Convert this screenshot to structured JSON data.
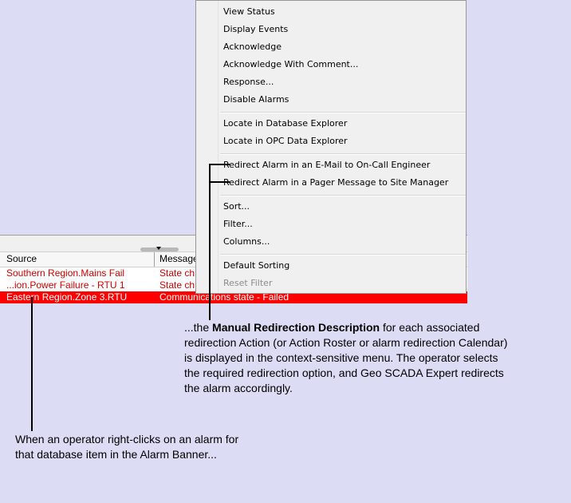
{
  "banner": {
    "columns": [
      "Source",
      "Message"
    ],
    "rows": [
      {
        "source": "Southern Region.Mains Fail",
        "message": "State ch",
        "style": "red"
      },
      {
        "source": "...ion.Power Failure - RTU 1",
        "message": "State ch",
        "style": "red"
      },
      {
        "source": "Eastern Region.Zone 3.RTU",
        "message": "Communications state - Failed",
        "style": "selected"
      }
    ]
  },
  "menu": {
    "groups": [
      [
        "View Status",
        "Display Events",
        "Acknowledge",
        "Acknowledge With Comment...",
        "Response...",
        "Disable Alarms"
      ],
      [
        "Locate in Database Explorer",
        "Locate in OPC Data Explorer"
      ],
      [
        "Redirect Alarm in an E-Mail to On-Call Engineer",
        "Redirect Alarm in a Pager Message to Site Manager"
      ],
      [
        "Sort...",
        "Filter...",
        "Columns..."
      ],
      [
        "Default Sorting",
        "Reset Filter"
      ]
    ]
  },
  "annotations": {
    "right_prefix": "...the ",
    "right_bold": "Manual Redirection Description",
    "right_line1_rest": " for each associated",
    "right_line2": "redirection Action (or Action Roster or alarm redirection Calendar)",
    "right_line3": "is displayed in the context-sensitive menu. The operator selects",
    "right_line4": "the required redirection option, and Geo SCADA Expert redirects",
    "right_line5": "the alarm accordingly.",
    "left_line1": "When an operator right-clicks on an alarm for",
    "left_line2": "that database item in the Alarm Banner..."
  }
}
